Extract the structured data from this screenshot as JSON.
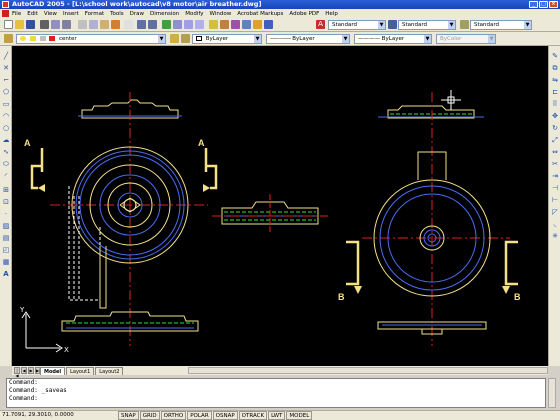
{
  "window": {
    "title": "AutoCAD 2005 - [L:\\school work\\autocad\\v8 motor\\air breather.dwg]"
  },
  "menu": [
    "File",
    "Edit",
    "View",
    "Insert",
    "Format",
    "Tools",
    "Draw",
    "Dimension",
    "Modify",
    "Window",
    "Acrobat Markups",
    "Adobe PDF",
    "Help"
  ],
  "styles": {
    "text_style": "Standard",
    "dim_style": "Standard",
    "table_style": "Standard"
  },
  "layers": {
    "current_layer": "center",
    "color": "ByLayer",
    "linetype": "ByLayer",
    "lineweight": "ByLayer",
    "plotstyle": "ByColor"
  },
  "drawing": {
    "label_a": "A",
    "label_b": "B",
    "ucs_x": "X",
    "ucs_y": "Y"
  },
  "tabs": [
    "Model",
    "Layout1",
    "Layout2"
  ],
  "command": {
    "line1": "Command:",
    "line2": "Command: _saveas",
    "line3": "Command:"
  },
  "status": {
    "coordinates": "71.7091, 29.3010, 0.0000",
    "buttons": [
      "SNAP",
      "GRID",
      "ORTHO",
      "POLAR",
      "OSNAP",
      "OTRACK",
      "LWT",
      "MODEL"
    ]
  },
  "colors": {
    "canvas": "#000000",
    "outline": "#f5e08a",
    "center": "#e02020",
    "circles": "#4a6cf0",
    "hidden": "#ffffff",
    "dashed": "#30e030"
  }
}
